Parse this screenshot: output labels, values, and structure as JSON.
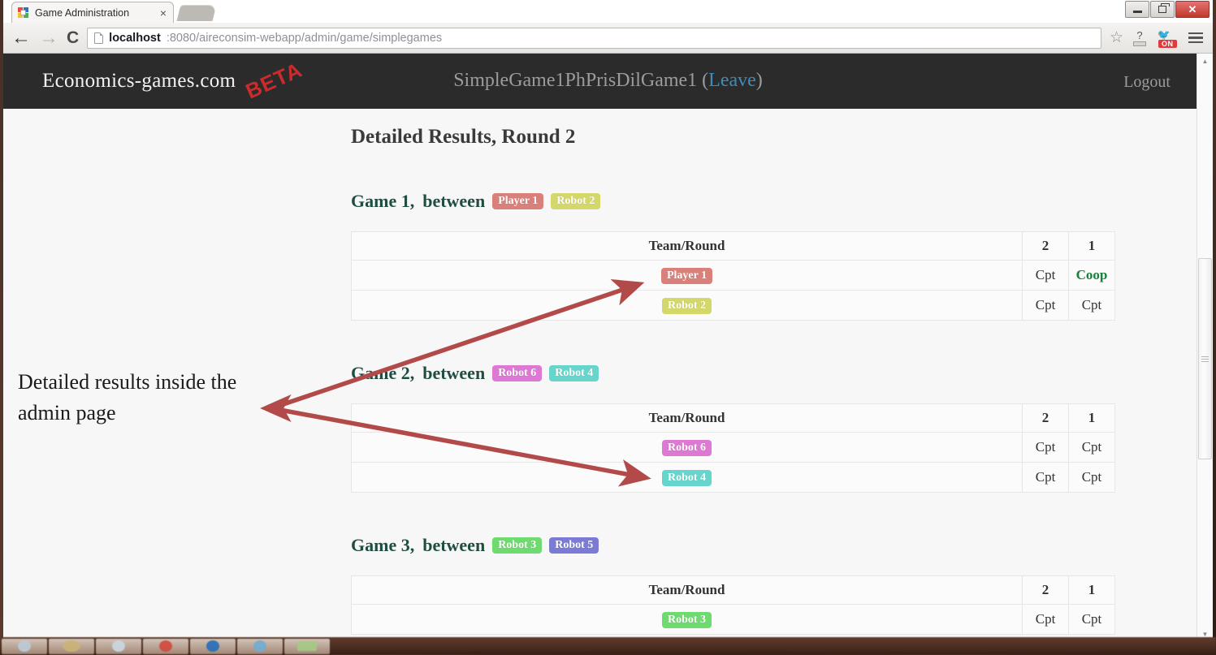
{
  "window": {
    "tab_title": "Game Administration",
    "tab_close": "×",
    "minimize": "",
    "maximize": "",
    "close": "✕"
  },
  "browser": {
    "back_icon": "←",
    "forward_icon": "→",
    "reload_icon": "C",
    "url_host": "localhost",
    "url_rest": ":8080/aireconsim-webapp/admin/game/simplegames",
    "star_icon": "☆",
    "help_icon": "?",
    "extension_badge": "ON",
    "menu_icon": "☰"
  },
  "site_header": {
    "brand": "Economics-games.com",
    "beta_stamp": "BETA",
    "game_title": "SimpleGame1PhPrisDilGame1",
    "leave_label": "Leave",
    "paren_open": "(",
    "paren_close": ")",
    "logout_label": "Logout"
  },
  "page": {
    "title": "Detailed Results, Round 2",
    "between_label": "between",
    "column_team": "Team/Round",
    "games": [
      {
        "heading": "Game 1, ",
        "teams": [
          {
            "name": "Player 1",
            "color": "#d9807a"
          },
          {
            "name": "Robot 2",
            "color": "#d4d769"
          }
        ],
        "rounds": [
          "2",
          "1"
        ],
        "rows": [
          {
            "team": "Player 1",
            "color": "#d9807a",
            "values": [
              "Cpt",
              "Coop"
            ],
            "highlight": [
              false,
              true
            ]
          },
          {
            "team": "Robot 2",
            "color": "#d4d769",
            "values": [
              "Cpt",
              "Cpt"
            ],
            "highlight": [
              false,
              false
            ]
          }
        ]
      },
      {
        "heading": "Game 2, ",
        "teams": [
          {
            "name": "Robot 6",
            "color": "#dd78d4"
          },
          {
            "name": "Robot 4",
            "color": "#66d6cd"
          }
        ],
        "rounds": [
          "2",
          "1"
        ],
        "rows": [
          {
            "team": "Robot 6",
            "color": "#dd78d4",
            "values": [
              "Cpt",
              "Cpt"
            ],
            "highlight": [
              false,
              false
            ]
          },
          {
            "team": "Robot 4",
            "color": "#66d6cd",
            "values": [
              "Cpt",
              "Cpt"
            ],
            "highlight": [
              false,
              false
            ]
          }
        ]
      },
      {
        "heading": "Game 3, ",
        "teams": [
          {
            "name": "Robot 3",
            "color": "#6edb6e"
          },
          {
            "name": "Robot 5",
            "color": "#7b7bd6"
          }
        ],
        "rounds": [
          "2",
          "1"
        ],
        "rows": [
          {
            "team": "Robot 3",
            "color": "#6edb6e",
            "values": [
              "Cpt",
              "Cpt"
            ],
            "highlight": [
              false,
              false
            ]
          }
        ]
      }
    ]
  },
  "annotation": {
    "text": "Detailed results inside the admin page",
    "arrow_color": "#b34a4a"
  },
  "scrollbar": {
    "up_arrow": "▲",
    "down_arrow": "▼"
  }
}
